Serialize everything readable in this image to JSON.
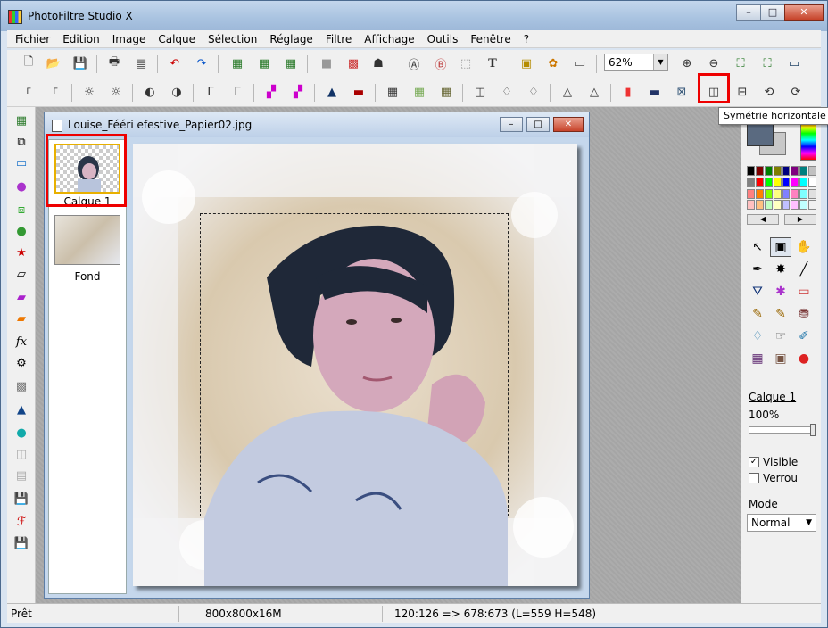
{
  "app": {
    "title": "PhotoFiltre Studio X"
  },
  "menu": [
    "Fichier",
    "Edition",
    "Image",
    "Calque",
    "Sélection",
    "Réglage",
    "Filtre",
    "Affichage",
    "Outils",
    "Fenêtre",
    "?"
  ],
  "toolbar": {
    "zoom_value": "62%"
  },
  "tooltip": {
    "text": "Symétrie horizontale"
  },
  "document": {
    "title": "Louise_Fééri efestive_Papier02.jpg",
    "layers": [
      {
        "label": "Calque 1"
      },
      {
        "label": "Fond"
      }
    ]
  },
  "right_panel": {
    "layer_name": "Calque 1",
    "opacity": "100%",
    "visible_label": "Visible",
    "lock_label": "Verrou",
    "mode_label": "Mode",
    "mode_value": "Normal"
  },
  "status": {
    "state": "Prêt",
    "image_info": "800x800x16M",
    "coords": "120:126 => 678:673 (L=559  H=548)"
  },
  "colors": {
    "foreground": "#5a6a80",
    "background": "#c8c8c8",
    "highlight": "#ee0000"
  },
  "palette": [
    "#000000",
    "#7f0000",
    "#007f00",
    "#7f7f00",
    "#00007f",
    "#7f007f",
    "#007f7f",
    "#c0c0c0",
    "#808080",
    "#ff0000",
    "#00ff00",
    "#ffff00",
    "#0000ff",
    "#ff00ff",
    "#00ffff",
    "#ffffff",
    "#ff8080",
    "#ff8000",
    "#80ff00",
    "#ffff80",
    "#8080ff",
    "#ff80c0",
    "#80ffff",
    "#e0e0e0",
    "#ffc0c0",
    "#ffc080",
    "#c0ffc0",
    "#ffffc0",
    "#c0c0ff",
    "#ffc0ff",
    "#c0ffff",
    "#f0f0f0"
  ]
}
